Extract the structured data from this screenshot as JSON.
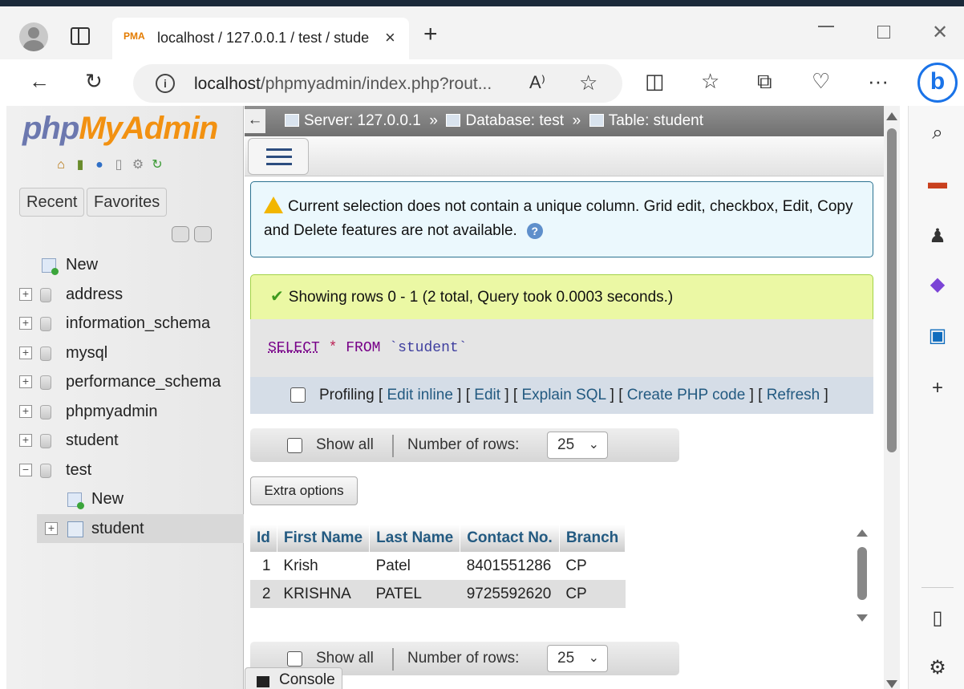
{
  "browser": {
    "tab_title": "localhost / 127.0.0.1 / test / stude",
    "tab_logo": "PMA",
    "url_main": "localhost",
    "url_rest": "/phpmyadmin/index.php?rout...",
    "icons": [
      "profile-icon",
      "tabs-icon",
      "back-icon",
      "refresh-icon",
      "info-icon",
      "read-aloud-icon",
      "favorite-star-icon",
      "split-screen-icon",
      "favorites-icon",
      "collections-icon",
      "health-icon",
      "more-icon",
      "bing-icon"
    ]
  },
  "edge_sidebar": {
    "icons": [
      "search-icon",
      "shopping-icon",
      "games-icon",
      "copilot-icon",
      "outlook-icon",
      "add-icon",
      "sidebar-toggle-icon",
      "settings-icon"
    ]
  },
  "pma": {
    "logo_php": "php",
    "logo_ma": "MyAdmin",
    "nav_buttons": {
      "recent": "Recent",
      "favorites": "Favorites"
    },
    "tree": {
      "new": "New",
      "databases": [
        "address",
        "information_schema",
        "mysql",
        "performance_schema",
        "phpmyadmin",
        "student",
        "test"
      ],
      "test_children": {
        "new": "New",
        "table": "student"
      }
    }
  },
  "main": {
    "breadcrumb": {
      "server": "Server: 127.0.0.1",
      "sep": "»",
      "database": "Database: test",
      "table": "Table: student"
    },
    "notice": {
      "text": "Current selection does not contain a unique column. Grid edit, checkbox, Edit, Copy and Delete features are not available."
    },
    "success": {
      "text": "Showing rows 0 - 1 (2 total, Query took 0.0003 seconds.)"
    },
    "sql": {
      "kw_select": "SELECT",
      "star": "*",
      "kw_from": "FROM",
      "table": "`student`"
    },
    "profiling": {
      "label": "Profiling",
      "links": [
        "Edit inline",
        "Edit",
        "Explain SQL",
        "Create PHP code",
        "Refresh"
      ]
    },
    "nav": {
      "show_all": "Show all",
      "number_of_rows": "Number of rows:",
      "rows_value": "25"
    },
    "extra_options": "Extra options",
    "table": {
      "columns": [
        "Id",
        "First Name",
        "Last Name",
        "Contact No.",
        "Branch"
      ],
      "rows": [
        [
          "1",
          "Krish",
          "Patel",
          "8401551286",
          "CP"
        ],
        [
          "2",
          "KRISHNA",
          "PATEL",
          "9725592620",
          "CP"
        ]
      ]
    },
    "console": "Console"
  }
}
